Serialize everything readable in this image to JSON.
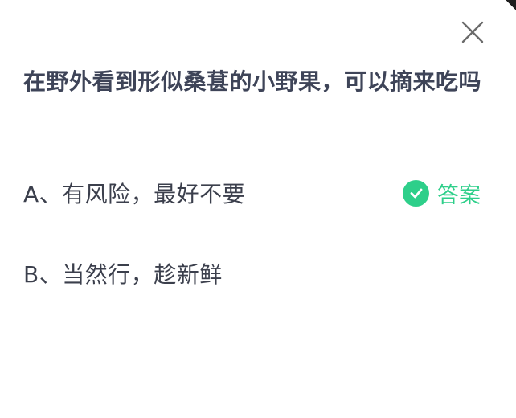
{
  "question": "在野外看到形似桑葚的小野果，可以摘来吃吗",
  "options": [
    {
      "label": "A、有风险，最好不要",
      "is_answer": true
    },
    {
      "label": "B、当然行，趁新鲜",
      "is_answer": false
    }
  ],
  "answer_badge": "答案",
  "colors": {
    "accent": "#2ecf8a",
    "question_text": "#3e4458",
    "option_text": "#3b3f4c",
    "close_icon": "#6b6b6b"
  },
  "icons": {
    "close": "close-icon",
    "answer": "check-circle-icon"
  }
}
